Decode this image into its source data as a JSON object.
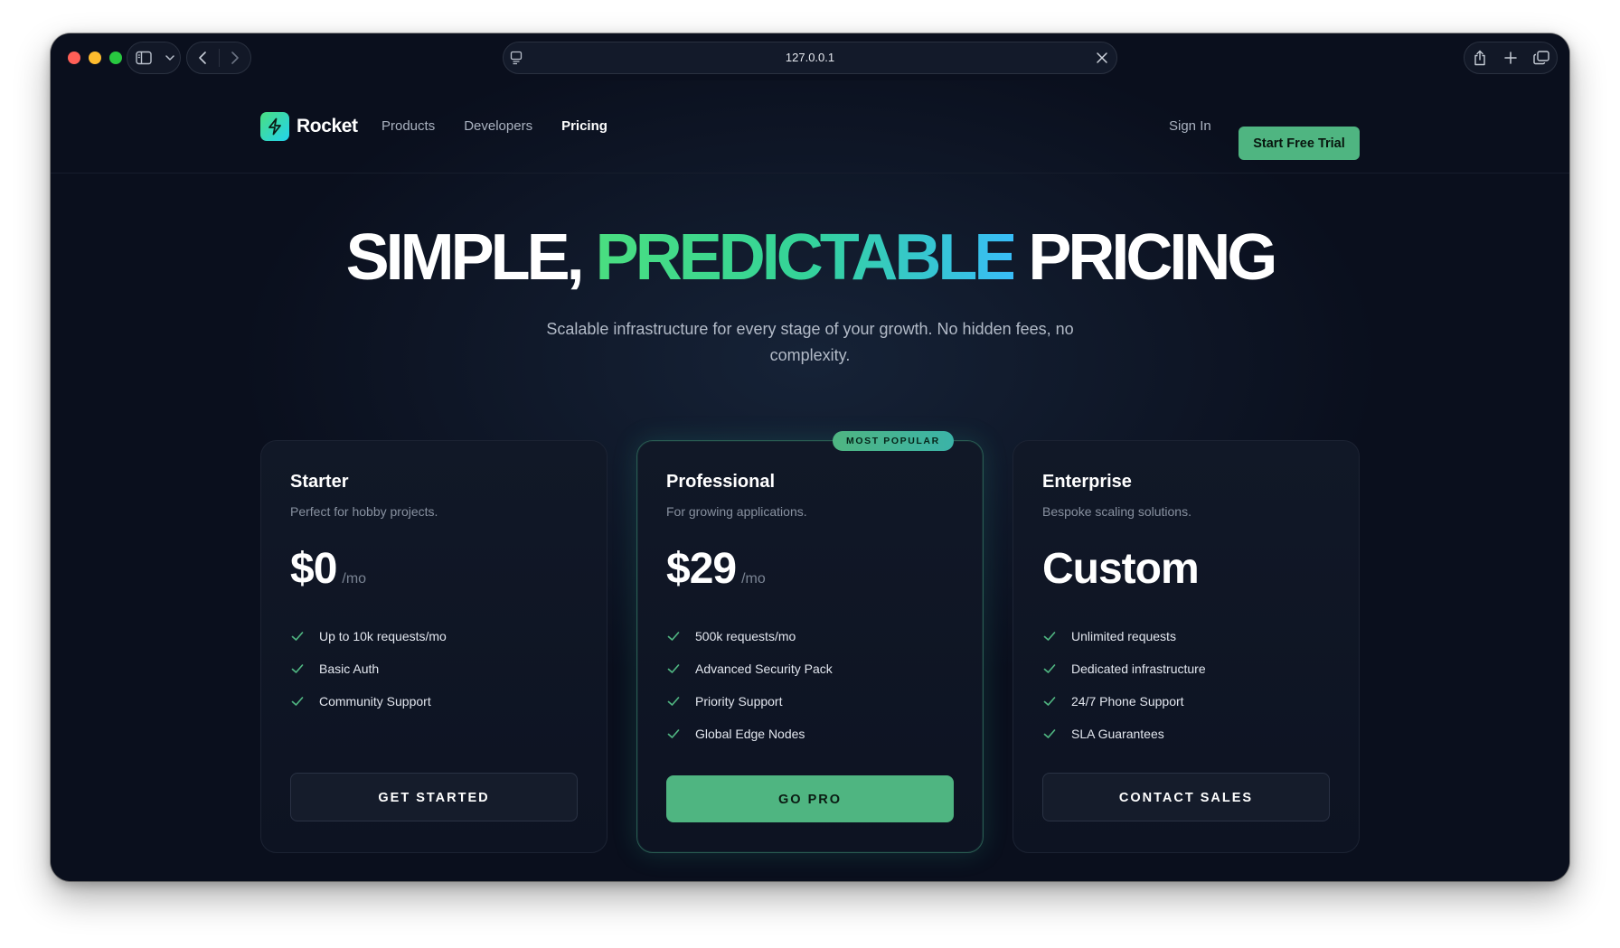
{
  "browser": {
    "url": "127.0.0.1"
  },
  "nav": {
    "brand": "Rocket",
    "links": [
      {
        "label": "Products",
        "active": false
      },
      {
        "label": "Developers",
        "active": false
      },
      {
        "label": "Pricing",
        "active": true
      }
    ],
    "sign_in": "Sign In",
    "cta": "Start Free Trial"
  },
  "hero": {
    "title_part1": "SIMPLE,",
    "title_highlight": "PREDICTABLE",
    "title_part2": "PRICING",
    "subtitle": "Scalable infrastructure for every stage of your growth. No hidden fees, no complexity."
  },
  "plans": [
    {
      "name": "Starter",
      "description": "Perfect for hobby projects.",
      "price": "$0",
      "period": "/mo",
      "features": [
        "Up to 10k requests/mo",
        "Basic Auth",
        "Community Support"
      ],
      "button": "GET STARTED"
    },
    {
      "name": "Professional",
      "description": "For growing applications.",
      "price": "$29",
      "period": "/mo",
      "badge": "MOST POPULAR",
      "features": [
        "500k requests/mo",
        "Advanced Security Pack",
        "Priority Support",
        "Global Edge Nodes"
      ],
      "button": "GO PRO"
    },
    {
      "name": "Enterprise",
      "description": "Bespoke scaling solutions.",
      "price": "Custom",
      "period": "",
      "features": [
        "Unlimited requests",
        "Dedicated infrastructure",
        "24/7 Phone Support",
        "SLA Guarantees"
      ],
      "button": "CONTACT SALES"
    }
  ],
  "colors": {
    "background": "#0a0f1d",
    "accent": "#4fb581",
    "gradient_start": "#4ade80",
    "gradient_end": "#38bdf8"
  }
}
